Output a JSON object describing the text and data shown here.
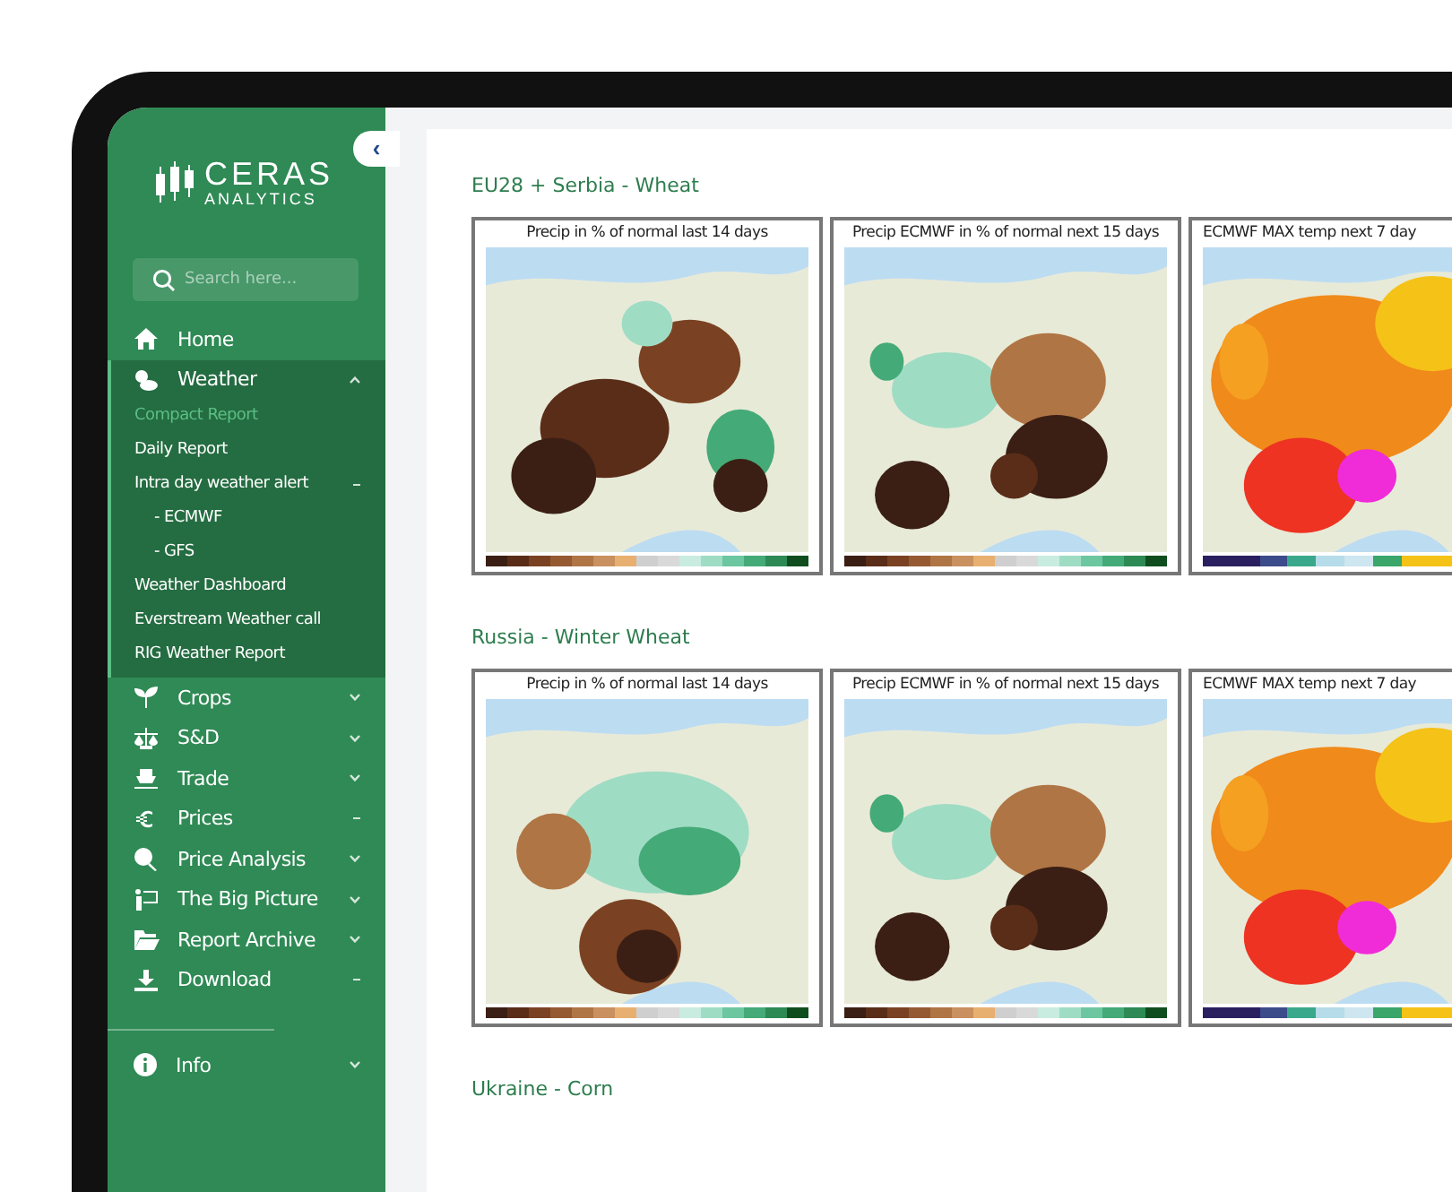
{
  "sidebar": {
    "collapse_button": "‹",
    "logo": {
      "name": "CERAS",
      "tagline": "ANALYTICS"
    },
    "search": {
      "placeholder": "Search here..."
    },
    "items": [
      {
        "label": "Home",
        "kind": "link",
        "expanded": false
      },
      {
        "label": "Weather",
        "kind": "menu",
        "expanded": true,
        "children": [
          {
            "label": "Compact Report",
            "kind": "page",
            "selected": true
          },
          {
            "label": "Daily Report",
            "kind": "page",
            "selected": false
          },
          {
            "label": "Intra day weather alert",
            "kind": "toggle",
            "selected": false,
            "children": [
              {
                "label": "- ECMWF",
                "selected": false
              },
              {
                "label": "- GFS",
                "selected": false
              }
            ]
          },
          {
            "label": "Weather Dashboard",
            "kind": "page",
            "selected": false
          },
          {
            "label": "Everstream Weather call",
            "kind": "page",
            "selected": false
          },
          {
            "label": "RIG Weather Report",
            "kind": "page",
            "selected": false
          }
        ]
      },
      {
        "label": "Crops",
        "kind": "menu",
        "expanded": false
      },
      {
        "label": "S&D",
        "kind": "menu",
        "expanded": false
      },
      {
        "label": "Trade",
        "kind": "menu",
        "expanded": false
      },
      {
        "label": "Prices",
        "kind": "toggle",
        "expanded": false
      },
      {
        "label": "Price Analysis",
        "kind": "menu",
        "expanded": false
      },
      {
        "label": "The Big Picture",
        "kind": "menu",
        "expanded": false
      },
      {
        "label": "Report Archive",
        "kind": "menu",
        "expanded": false
      },
      {
        "label": "Download",
        "kind": "toggle",
        "expanded": false
      }
    ],
    "footer_items": [
      {
        "label": "Info",
        "kind": "menu",
        "expanded": false
      }
    ]
  },
  "sections": [
    {
      "title": "EU28 + Serbia - Wheat",
      "panels": [
        {
          "title": "Precip in % of normal last 14 days",
          "kind": "precip-dry"
        },
        {
          "title": "Precip ECMWF in % of normal next 15 days",
          "kind": "precip-mixed"
        },
        {
          "title": "ECMWF MAX temp next 7 day",
          "kind": "temp"
        }
      ]
    },
    {
      "title": "Russia - Winter Wheat",
      "panels": [
        {
          "title": "Precip in % of normal last 14 days",
          "kind": "precip-wet"
        },
        {
          "title": "Precip ECMWF in % of normal next 15 days",
          "kind": "precip-mixed"
        },
        {
          "title": "ECMWF MAX temp next 7 day",
          "kind": "temp"
        }
      ]
    },
    {
      "title": "Ukraine - Corn"
    }
  ]
}
